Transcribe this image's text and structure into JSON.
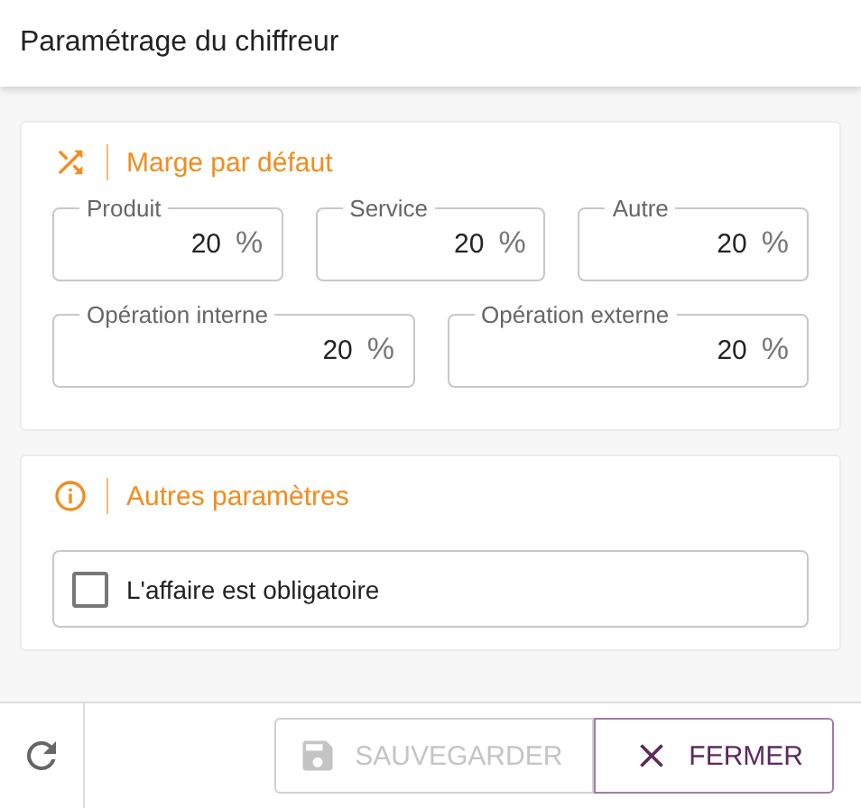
{
  "window": {
    "title": "Paramétrage du chiffreur"
  },
  "sections": [
    {
      "kind": "margins",
      "title": "Marge par défaut",
      "field_rows": [
        {
          "fields": [
            {
              "label": "Produit",
              "value": "20",
              "unit": "%"
            },
            {
              "label": "Service",
              "value": "20",
              "unit": "%"
            },
            {
              "label": "Autre",
              "value": "20",
              "unit": "%"
            }
          ]
        },
        {
          "fields": [
            {
              "label": "Opération interne",
              "value": "20",
              "unit": "%"
            },
            {
              "label": "Opération externe",
              "value": "20",
              "unit": "%"
            }
          ]
        }
      ]
    },
    {
      "kind": "options",
      "title": "Autres paramètres",
      "checkboxes": [
        {
          "label": "L'affaire est obligatoire",
          "checked": false
        }
      ]
    }
  ],
  "footer": {
    "buttons": [
      {
        "kind": "save",
        "label": "SAUVEGARDER",
        "disabled": true
      },
      {
        "kind": "close",
        "label": "FERMER",
        "disabled": false
      }
    ]
  }
}
